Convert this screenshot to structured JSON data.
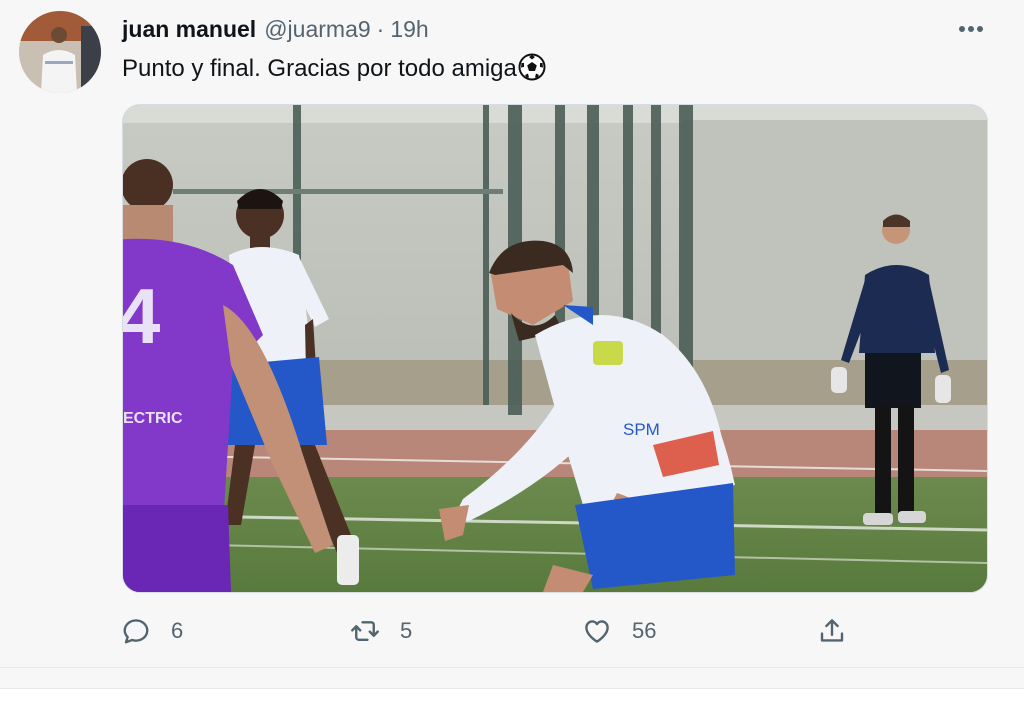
{
  "tweet": {
    "author_name": "juan manuel",
    "author_handle": "@juarma9",
    "separator": "·",
    "time": "19h",
    "text": "Punto y final. Gracias por todo amiga",
    "emoji_icon": "soccer-ball-icon"
  },
  "media": {
    "jersey_number": "4",
    "sponsor_text": "ECTRIC",
    "shirt_text": "SPM"
  },
  "actions": {
    "reply_count": "6",
    "retweet_count": "5",
    "like_count": "56"
  },
  "colors": {
    "text": "#0f1419",
    "muted": "#536471",
    "background": "#f7f7f7",
    "purple_kit": "#8238c9",
    "blue_kit": "#2458c9"
  }
}
